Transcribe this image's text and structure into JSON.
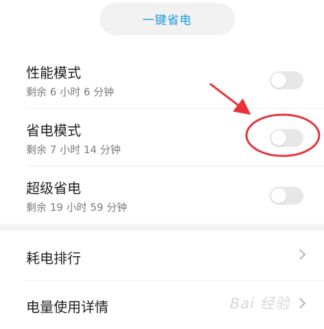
{
  "header": {
    "one_key_label": "一键省电"
  },
  "modes": [
    {
      "title": "性能模式",
      "remaining": "剩余 6 小时 6 分钟",
      "enabled": false
    },
    {
      "title": "省电模式",
      "remaining": "剩余 7 小时 14 分钟",
      "enabled": false
    },
    {
      "title": "超级省电",
      "remaining": "剩余 19 小时 59 分钟",
      "enabled": false
    }
  ],
  "nav": [
    {
      "label": "耗电排行"
    },
    {
      "label": "电量使用详情"
    }
  ],
  "colors": {
    "accent": "#1a9bd8",
    "annotation": "#e8333a"
  },
  "watermark": "Bai 经验"
}
